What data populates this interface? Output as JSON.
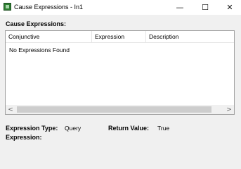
{
  "window": {
    "title": "Cause Expressions - In1",
    "minimize_glyph": "—",
    "maximize_glyph": "☐",
    "close_glyph": "✕",
    "icon": "app-icon"
  },
  "section_label": "Cause Expressions:",
  "list": {
    "columns": [
      "Conjunctive",
      "Expression",
      "Description"
    ],
    "empty_message": "No Expressions Found",
    "scroll_left_glyph": "<",
    "scroll_right_glyph": ">"
  },
  "fields": {
    "expression_type_label": "Expression Type:",
    "expression_type_value": "Query",
    "return_value_label": "Return Value:",
    "return_value_value": "True",
    "expression_label": "Expression:"
  }
}
